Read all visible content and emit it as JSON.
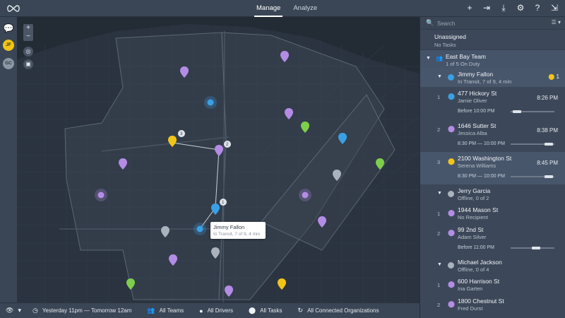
{
  "nav": {
    "tabs": [
      {
        "label": "Manage",
        "active": true
      },
      {
        "label": "Analyze",
        "active": false
      }
    ]
  },
  "top_actions": [
    "add-icon",
    "import-icon",
    "download-icon",
    "settings-icon",
    "help-icon",
    "logout-icon"
  ],
  "left_rail": {
    "chat_icon": "chat-add-icon",
    "avatars": [
      "JF",
      "GC"
    ]
  },
  "map": {
    "zoom_in": "+",
    "zoom_out": "−",
    "tooltip": {
      "name": "Jimmy Fallon",
      "status": "In Transit, 7 of 9, 4 min"
    },
    "route_numbers": [
      "1",
      "2",
      "3"
    ],
    "colors": {
      "driver": "#3aa0e6",
      "task_purple": "#b48ce6",
      "task_yellow": "#f2c417",
      "task_green": "#7dcf4a",
      "task_gray": "#aab3bd",
      "zone": "#3b4553"
    }
  },
  "bottom_bar": {
    "filter_icon": "binoculars-icon",
    "time_range": "Yesterday 11pm — Tomorrow 12am",
    "teams": "All Teams",
    "drivers": "All Drivers",
    "tasks": "All Tasks",
    "organizations": "All Connected Organizations"
  },
  "panel": {
    "search_placeholder": "Search",
    "unassigned": {
      "title": "Unassigned",
      "subtitle": "No Tasks"
    },
    "team": {
      "name": "East Bay Team",
      "status": "1 of 5 On Duty"
    },
    "drivers": [
      {
        "name": "Jimmy Fallon",
        "status": "In Transit, 7 of 9, 4 min",
        "color": "#3aa0e6",
        "alert_count": "1",
        "tasks": [
          {
            "num": "1",
            "address": "477 Hickory St",
            "recipient": "Jamie Oliver",
            "eta": "8:26 PM",
            "window": "Before 10:00 PM",
            "pin_color": "#3aa0e6"
          },
          {
            "num": "2",
            "address": "1646 Sutter St",
            "recipient": "Jessica Alba",
            "eta": "8:38 PM",
            "window": "8:30 PM — 10:00 PM",
            "pin_color": "#b48ce6"
          },
          {
            "num": "3",
            "address": "2100 Washington St",
            "recipient": "Serena Williams",
            "eta": "8:45 PM",
            "window": "8:30 PM — 10:00 PM",
            "pin_color": "#f2c417"
          }
        ]
      },
      {
        "name": "Jerry Garcia",
        "status": "Offline, 0 of 2",
        "color": "#aab3bd",
        "tasks": [
          {
            "num": "1",
            "address": "1944 Mason St",
            "recipient": "No Recipient",
            "eta": "",
            "window": "",
            "pin_color": "#b48ce6"
          },
          {
            "num": "2",
            "address": "99 2nd St",
            "recipient": "Adam Silver",
            "eta": "",
            "window": "Before 11:00 PM",
            "pin_color": "#b48ce6"
          }
        ]
      },
      {
        "name": "Michael Jackson",
        "status": "Offline, 0 of 4",
        "color": "#aab3bd",
        "tasks": [
          {
            "num": "1",
            "address": "600 Harrison St",
            "recipient": "Ina Garten",
            "pin_color": "#b48ce6"
          },
          {
            "num": "2",
            "address": "1800 Chestnut St",
            "recipient": "Fred Durst",
            "pin_color": "#b48ce6"
          }
        ]
      }
    ]
  }
}
